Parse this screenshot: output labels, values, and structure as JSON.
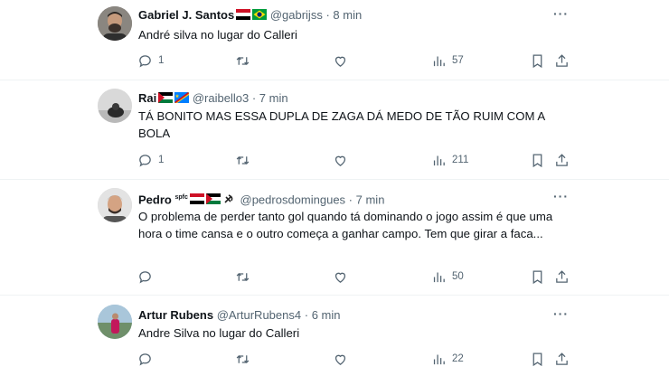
{
  "tweets": [
    {
      "name": "Gabriel J. Santos",
      "handle": "@gabrijss",
      "dot": "·",
      "time": "8 min",
      "text": "André silva no lugar do Calleri",
      "replies": "1",
      "retweets": "",
      "likes": "",
      "views": "57"
    },
    {
      "name": "Rai",
      "handle": "@raibello3",
      "dot": "·",
      "time": "7 min",
      "text": "TÁ BONITO MAS ESSA DUPLA DE ZAGA DÁ MEDO DE TÃO RUIM COM A BOLA",
      "replies": "1",
      "retweets": "",
      "likes": "",
      "views": "211"
    },
    {
      "name": "Pedro",
      "name_suffix": "spfc",
      "handle": "@pedrosdomingues",
      "dot": "·",
      "time": "7 min",
      "text": "O problema de perder tanto gol quando tá dominando o jogo assim é que uma hora o time cansa e o outro começa a ganhar campo. Tem que girar a faca...",
      "replies": "",
      "retweets": "",
      "likes": "",
      "views": "50"
    },
    {
      "name": "Artur Rubens",
      "handle": "@ArturRubens4",
      "dot": "·",
      "time": "6 min",
      "text": "Andre Silva no lugar do Calleri",
      "replies": "",
      "retweets": "",
      "likes": "",
      "views": "22"
    }
  ],
  "more_label": "···",
  "icons": {
    "reply": "reply-icon",
    "retweet": "retweet-icon",
    "like": "like-icon",
    "views": "views-icon",
    "bookmark": "bookmark-icon",
    "share": "share-icon"
  },
  "colors": {
    "secondary_text": "#536471",
    "divider": "#eff3f4"
  }
}
